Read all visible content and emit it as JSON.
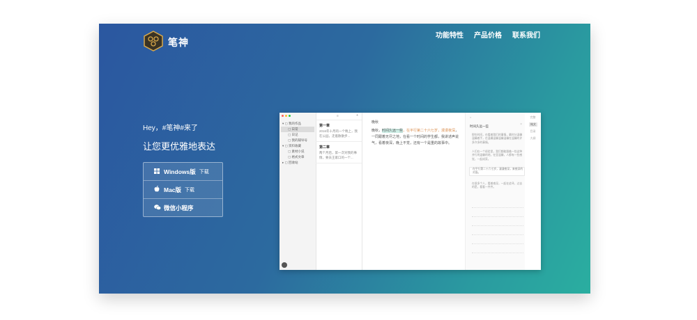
{
  "brand": {
    "name": "笔神"
  },
  "nav": {
    "items": [
      "功能特性",
      "产品价格",
      "联系我们"
    ]
  },
  "hero": {
    "greeting": "Hey，#笔神#来了",
    "slogan": "让您更优雅地表达"
  },
  "downloads": [
    {
      "label": "Windows版",
      "sub": "下载",
      "icon": "windows-icon"
    },
    {
      "label": "Mac版",
      "sub": "下载",
      "icon": "apple-icon"
    },
    {
      "label": "微信小程序",
      "sub": "",
      "icon": "wechat-icon"
    }
  ],
  "colors": {
    "gradient_start": "#2b57a0",
    "gradient_end": "#2aaea0",
    "logo_bg": "#3a3324",
    "logo_accent": "#d8a84a"
  },
  "app": {
    "tree": [
      {
        "label": "我的作品",
        "level": 1,
        "selected": false
      },
      {
        "label": "日常",
        "level": 2,
        "selected": true
      },
      {
        "label": "日记",
        "level": 2,
        "selected": false
      },
      {
        "label": "我的辅导号",
        "level": 2,
        "selected": false
      },
      {
        "label": "资料收藏",
        "level": 1,
        "selected": false
      },
      {
        "label": "素材小说",
        "level": 2,
        "selected": false
      },
      {
        "label": "格式文章",
        "level": 2,
        "selected": false
      },
      {
        "label": "回收站",
        "level": 1,
        "selected": false
      }
    ],
    "notes": [
      {
        "title": "第一章",
        "snippet": "2016年十月的一个晚上，我在公园，走着散散步..."
      },
      {
        "title": "第二章",
        "snippet": "两个月后，第一次对我的事情，要去王家口的一个..."
      }
    ],
    "editor_title": "晚秋",
    "editor_text": {
      "before": "晚秋，",
      "highlight": "时间久远一些",
      "colored": "，在平行第二十六七岁，漫漫夜深",
      "after": "，一同跟着无尽之地，在看一个时间的学生都，我讲述声说气，看着夜深，晚上不觉，还有一个是重的故事中。"
    },
    "panel_title": "时间久远一些",
    "panel_blocks": [
      "那些时间，在看着我们的事情，最时分温馨温馨着手，在温馨温馨温馨温馨在温馨的许多许多的事情。",
      "人们在一个经验里，我们都能跟着一些这种并行的温馨的地，在里温馨，人都有一些感觉，一起成家。",
      "在平行第二十六七岁，漫漫夜深，来夜深的对面。",
      "在很多个人，看着夜深，一起在追寻，过去的是，看看一件件。"
    ],
    "rail": [
      "完整",
      "纯文",
      "目录",
      "大纲"
    ]
  }
}
